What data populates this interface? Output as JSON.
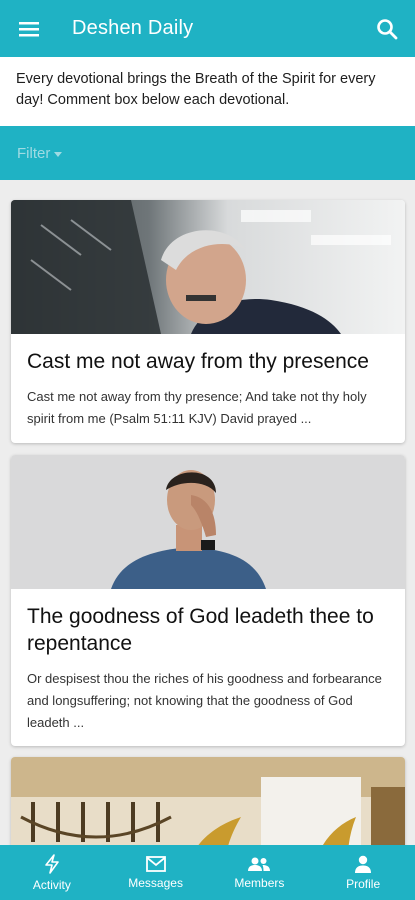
{
  "appbar": {
    "title": "Deshen Daily",
    "menu_icon": "menu-icon",
    "search_icon": "search-icon"
  },
  "intro": {
    "text": "Every devotional brings the Breath of the Spirit for every day! Comment box below each devotional."
  },
  "filter": {
    "label": "Filter"
  },
  "cards": [
    {
      "title": "Cast me not away from thy presence",
      "excerpt": "Cast me not away from thy presence; And take not thy holy spirit from me (Psalm 51:11 KJV) David prayed ..."
    },
    {
      "title": "The goodness of God leadeth thee to repentance",
      "excerpt": "Or despisest thou the riches of his goodness and forbearance and longsuffering; not knowing that the goodness of God leadeth ..."
    }
  ],
  "bottom_nav": [
    {
      "label": "Activity",
      "icon": "activity-icon"
    },
    {
      "label": "Messages",
      "icon": "messages-icon"
    },
    {
      "label": "Members",
      "icon": "members-icon"
    },
    {
      "label": "Profile",
      "icon": "profile-icon"
    }
  ],
  "colors": {
    "brand": "#1fb2c4",
    "background": "#ededed",
    "card": "#ffffff"
  }
}
